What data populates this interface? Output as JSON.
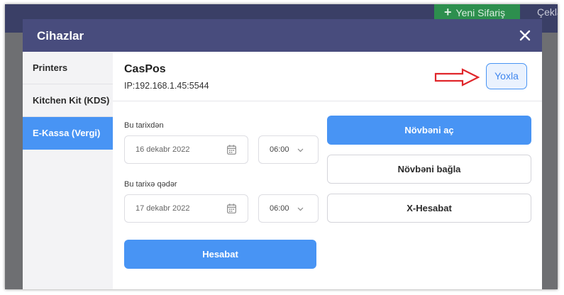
{
  "background": {
    "green_button_label": "Yeni Sifariş",
    "right_text": "Çekla"
  },
  "modal": {
    "title": "Cihazlar"
  },
  "sidebar": {
    "items": [
      {
        "label": "Printers"
      },
      {
        "label": "Kitchen Kit (KDS)"
      },
      {
        "label": "E-Kassa (Vergi)"
      }
    ],
    "active_index": 2
  },
  "device": {
    "name": "CasPos",
    "ip": "IP:192.168.1.45:5544",
    "check_label": "Yoxla"
  },
  "report": {
    "from_label": "Bu tarixdən",
    "from_date": "16 dekabr 2022",
    "from_time": "06:00",
    "to_label": "Bu tarixə qədər",
    "to_date": "17 dekabr 2022",
    "to_time": "06:00",
    "report_button": "Hesabat"
  },
  "shift": {
    "open_button": "Növbəni aç",
    "close_button": "Növbəni bağla",
    "x_report_button": "X-Hesabat"
  },
  "colors": {
    "accent": "#4894f4",
    "header": "#484c7d",
    "annotation_arrow": "#e0262b",
    "new_order_green": "#2d8f4e"
  },
  "icons": {
    "close": "close-icon",
    "calendar": "calendar-icon",
    "chevron": "chevron-down-icon",
    "arrow": "red-arrow-icon",
    "plus": "plus-icon"
  }
}
